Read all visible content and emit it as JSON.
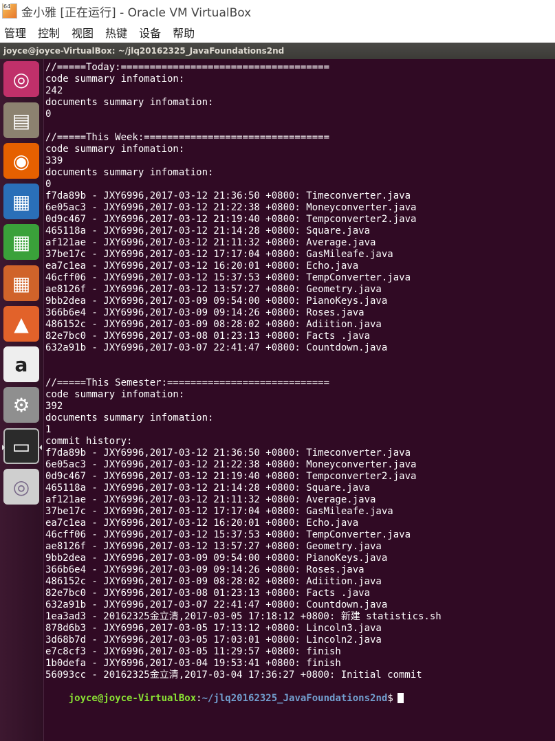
{
  "vbox": {
    "app_icon_badge": "64",
    "title": "金小雅 [正在运行] - Oracle VM VirtualBox",
    "menu": [
      "管理",
      "控制",
      "视图",
      "热键",
      "设备",
      "帮助"
    ]
  },
  "terminal": {
    "title": "joyce@joyce-VirtualBox: ~/jlq20162325_JavaFoundations2nd",
    "lines": [
      "//=====Today:====================================",
      "code summary infomation:",
      "242",
      "documents summary infomation:",
      "0",
      "",
      "//=====This Week:================================",
      "code summary infomation:",
      "339",
      "documents summary infomation:",
      "0",
      "f7da89b - JXY6996,2017-03-12 21:36:50 +0800: Timeconverter.java",
      "6e05ac3 - JXY6996,2017-03-12 21:22:38 +0800: Moneyconverter.java",
      "0d9c467 - JXY6996,2017-03-12 21:19:40 +0800: Tempconverter2.java",
      "465118a - JXY6996,2017-03-12 21:14:28 +0800: Square.java",
      "af121ae - JXY6996,2017-03-12 21:11:32 +0800: Average.java",
      "37be17c - JXY6996,2017-03-12 17:17:04 +0800: GasMileafe.java",
      "ea7c1ea - JXY6996,2017-03-12 16:20:01 +0800: Echo.java",
      "46cff06 - JXY6996,2017-03-12 15:37:53 +0800: TempConverter.java",
      "ae8126f - JXY6996,2017-03-12 13:57:27 +0800: Geometry.java",
      "9bb2dea - JXY6996,2017-03-09 09:54:00 +0800: PianoKeys.java",
      "366b6e4 - JXY6996,2017-03-09 09:14:26 +0800: Roses.java",
      "486152c - JXY6996,2017-03-09 08:28:02 +0800: Adiition.java",
      "82e7bc0 - JXY6996,2017-03-08 01:23:13 +0800: Facts .java",
      "632a91b - JXY6996,2017-03-07 22:41:47 +0800: Countdown.java",
      "",
      "",
      "//=====This Semester:============================",
      "code summary infomation:",
      "392",
      "documents summary infomation:",
      "1",
      "commit history:",
      "f7da89b - JXY6996,2017-03-12 21:36:50 +0800: Timeconverter.java",
      "6e05ac3 - JXY6996,2017-03-12 21:22:38 +0800: Moneyconverter.java",
      "0d9c467 - JXY6996,2017-03-12 21:19:40 +0800: Tempconverter2.java",
      "465118a - JXY6996,2017-03-12 21:14:28 +0800: Square.java",
      "af121ae - JXY6996,2017-03-12 21:11:32 +0800: Average.java",
      "37be17c - JXY6996,2017-03-12 17:17:04 +0800: GasMileafe.java",
      "ea7c1ea - JXY6996,2017-03-12 16:20:01 +0800: Echo.java",
      "46cff06 - JXY6996,2017-03-12 15:37:53 +0800: TempConverter.java",
      "ae8126f - JXY6996,2017-03-12 13:57:27 +0800: Geometry.java",
      "9bb2dea - JXY6996,2017-03-09 09:54:00 +0800: PianoKeys.java",
      "366b6e4 - JXY6996,2017-03-09 09:14:26 +0800: Roses.java",
      "486152c - JXY6996,2017-03-09 08:28:02 +0800: Adiition.java",
      "82e7bc0 - JXY6996,2017-03-08 01:23:13 +0800: Facts .java",
      "632a91b - JXY6996,2017-03-07 22:41:47 +0800: Countdown.java",
      "1ea3ad3 - 20162325金立清,2017-03-05 17:18:12 +0800: 新建 statistics.sh",
      "878d6b3 - JXY6996,2017-03-05 17:13:12 +0800: Lincoln3.java",
      "3d68b7d - JXY6996,2017-03-05 17:03:01 +0800: Lincoln2.java",
      "e7c8cf3 - JXY6996,2017-03-05 11:29:57 +0800: finish",
      "1b0defa - JXY6996,2017-03-04 19:53:41 +0800: finish",
      "56093cc - 20162325金立清,2017-03-04 17:36:27 +0800: Initial commit"
    ],
    "prompt": {
      "user_host": "joyce@joyce-VirtualBox",
      "colon": ":",
      "path": "~/jlq20162325_JavaFoundations2nd",
      "symbol": "$"
    },
    "colors": {
      "background": "#300a24",
      "user_host": "#8ae234",
      "path": "#729fcf",
      "text": "#ffffff"
    }
  },
  "launcher": {
    "items": [
      {
        "name": "ubuntu-dash-icon",
        "glyph": "◎",
        "color": "#c0306a"
      },
      {
        "name": "files-icon",
        "glyph": "▤",
        "color": "#8c8270"
      },
      {
        "name": "firefox-icon",
        "glyph": "◉",
        "color": "#e66000"
      },
      {
        "name": "libreoffice-writer-icon",
        "glyph": "▦",
        "color": "#2a6fb8"
      },
      {
        "name": "libreoffice-calc-icon",
        "glyph": "▦",
        "color": "#3aa13a"
      },
      {
        "name": "libreoffice-impress-icon",
        "glyph": "▦",
        "color": "#d0632a"
      },
      {
        "name": "software-center-icon",
        "glyph": "▲",
        "color": "#e2622a"
      },
      {
        "name": "amazon-icon",
        "glyph": "a",
        "color": "#eeeeee"
      },
      {
        "name": "system-settings-icon",
        "glyph": "⚙",
        "color": "#8f8f8f"
      },
      {
        "name": "terminal-icon",
        "glyph": "▭",
        "color": "#2b2b2b"
      },
      {
        "name": "dvd-icon",
        "glyph": "◎",
        "color": "#cfcfcf"
      }
    ]
  }
}
